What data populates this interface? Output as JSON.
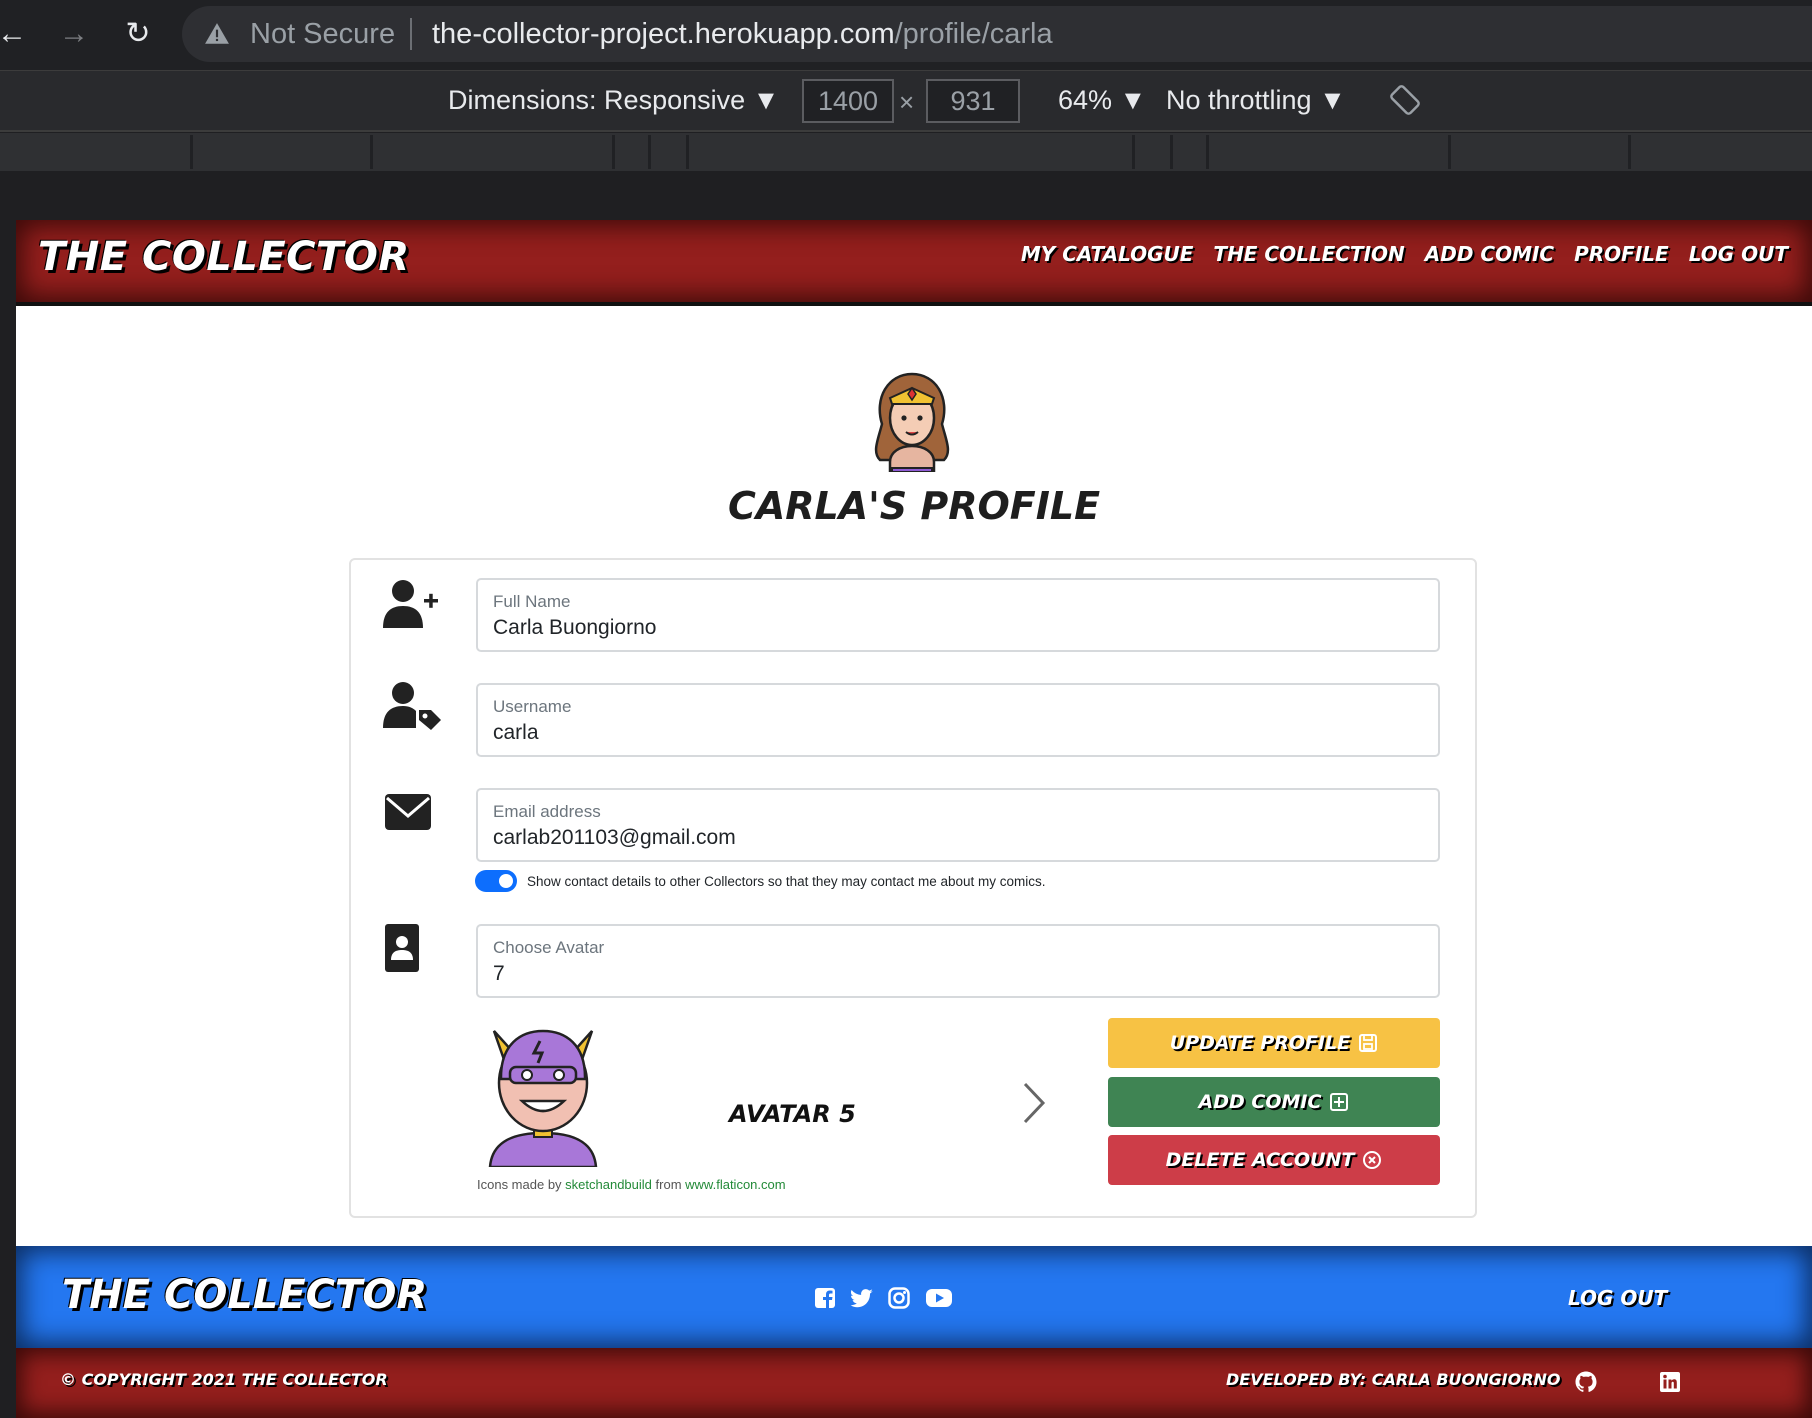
{
  "browser": {
    "security_label": "Not Secure",
    "url_host": "the-collector-project.herokuapp.com",
    "url_path": "/profile/carla"
  },
  "devtools": {
    "dimensions_label": "Dimensions: Responsive ▼",
    "width": "1400",
    "height": "931",
    "zoom": "64% ▼",
    "throttling": "No throttling ▼"
  },
  "header": {
    "brand": "THE COLLECTOR",
    "nav": [
      "MY CATALOGUE",
      "THE COLLECTION",
      "ADD COMIC",
      "PROFILE",
      "LOG OUT"
    ]
  },
  "profile": {
    "title": "CARLA'S PROFILE",
    "fields": {
      "full_name": {
        "label": "Full Name",
        "value": "Carla Buongiorno"
      },
      "username": {
        "label": "Username",
        "value": "carla"
      },
      "email": {
        "label": "Email address",
        "value": "carlab201103@gmail.com"
      },
      "avatar": {
        "label": "Choose Avatar",
        "value": "7"
      }
    },
    "contact_toggle": {
      "label": "Show contact details to other Collectors so that they may contact me about my comics.",
      "checked": true
    },
    "avatar_caption": "AVATAR 5",
    "credit": {
      "prefix": "Icons made by",
      "author": "sketchandbuild",
      "middle": "from",
      "site": "www.flaticon.com"
    },
    "buttons": {
      "update": "UPDATE PROFILE",
      "add": "ADD COMIC",
      "delete": "DELETE ACCOUNT"
    }
  },
  "footer": {
    "brand": "THE COLLECTOR",
    "social": [
      "facebook-icon",
      "twitter-icon",
      "instagram-icon",
      "youtube-icon"
    ],
    "logout": "LOG OUT",
    "copyright": "© COPYRIGHT 2021 THE COLLECTOR",
    "developer": "DEVELOPED BY: CARLA BUONGIORNO"
  },
  "colors": {
    "header_red": "#941f1d",
    "footer_blue": "#2477f0",
    "update_yellow": "#f7c244",
    "add_green": "#3f8453",
    "delete_red": "#cd3d48",
    "toggle_blue": "#0d6efd"
  }
}
